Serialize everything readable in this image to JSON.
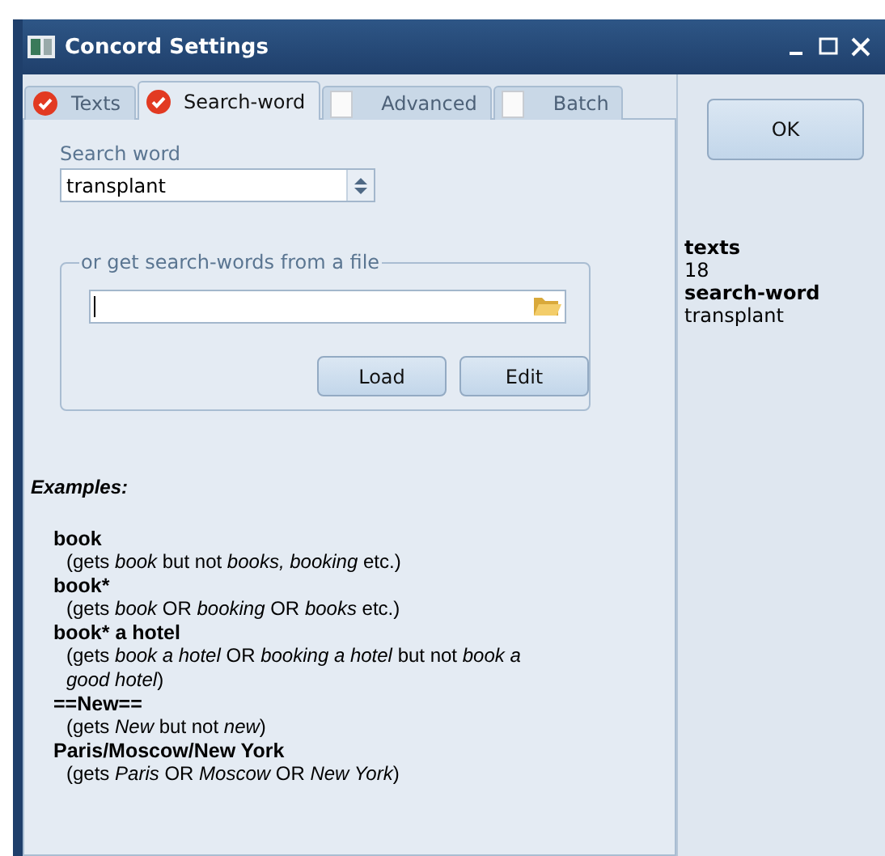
{
  "window": {
    "title": "Concord Settings"
  },
  "tabs": [
    {
      "label": "Texts",
      "checked": true,
      "selected": false
    },
    {
      "label": "Search-word",
      "checked": true,
      "selected": true
    },
    {
      "label": "Advanced",
      "checked": false,
      "selected": false
    },
    {
      "label": "Batch",
      "checked": false,
      "selected": false
    }
  ],
  "search_word": {
    "label": "Search word",
    "value": "transplant"
  },
  "file_group": {
    "legend": "or get search-words from a file",
    "buttons": [
      "Load",
      "Edit"
    ]
  },
  "examples": {
    "heading": "Examples:",
    "items": [
      {
        "pattern": "book",
        "gloss": "(gets *book* but not *books, booking* etc.)"
      },
      {
        "pattern": "book*",
        "gloss": "(gets *book* OR *booking* OR *books* etc.)"
      },
      {
        "pattern": "book* a hotel",
        "gloss": "(gets *book a hotel* OR *booking a hotel* but not *book a good hotel*)"
      },
      {
        "pattern": "==New==",
        "gloss": "(gets *New* but not *new*)"
      },
      {
        "pattern": "Paris/Moscow/New York",
        "gloss": "(gets *Paris* OR *Moscow* OR *New York*)"
      }
    ]
  },
  "ok_button": "OK",
  "summary": [
    {
      "label": "texts",
      "value": "18"
    },
    {
      "label": "search-word",
      "value": "transplant"
    }
  ]
}
